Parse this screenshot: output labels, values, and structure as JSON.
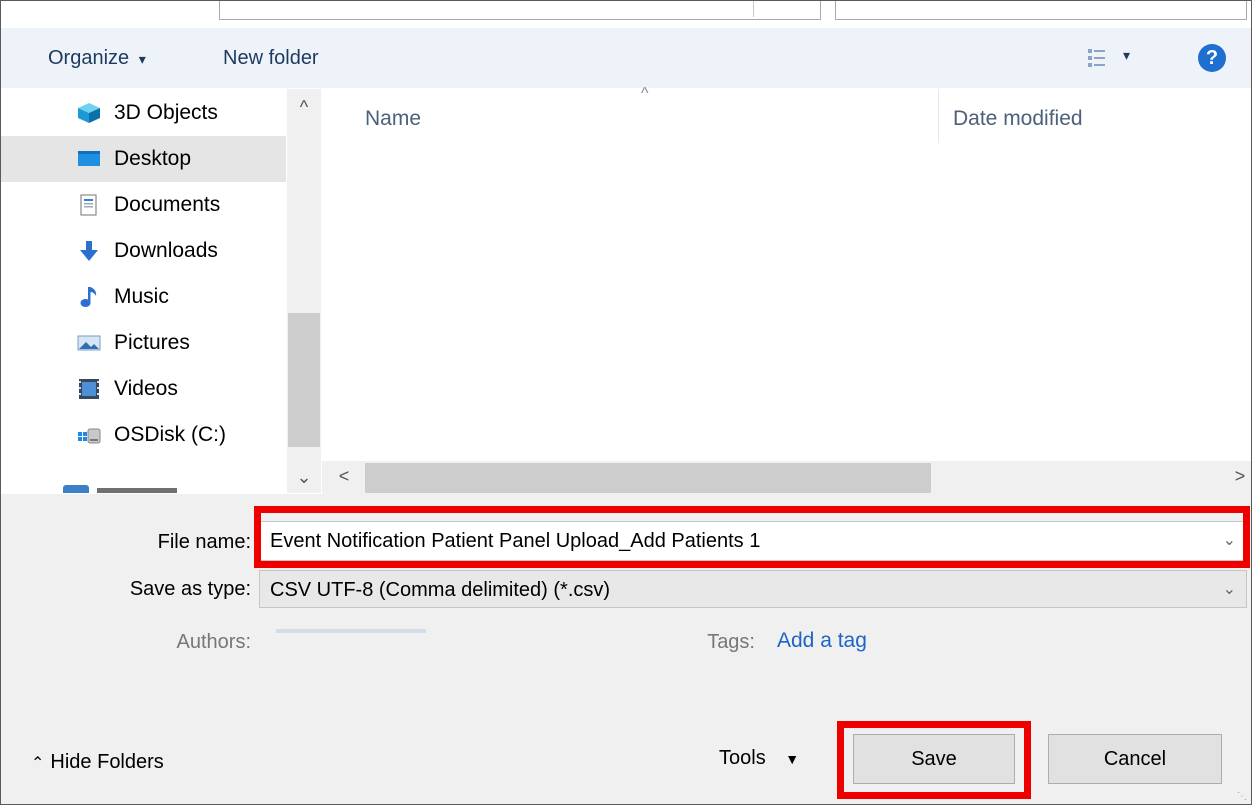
{
  "toolbar": {
    "organize_label": "Organize",
    "organize_arrow": "▾",
    "new_folder_label": "New folder",
    "view_arrow": "▾",
    "help_label": "?"
  },
  "nav": {
    "items": [
      {
        "label": "3D Objects",
        "icon": "3d-objects-icon"
      },
      {
        "label": "Desktop",
        "icon": "desktop-icon",
        "selected": true
      },
      {
        "label": "Documents",
        "icon": "documents-icon"
      },
      {
        "label": "Downloads",
        "icon": "downloads-icon"
      },
      {
        "label": "Music",
        "icon": "music-icon"
      },
      {
        "label": "Pictures",
        "icon": "pictures-icon"
      },
      {
        "label": "Videos",
        "icon": "videos-icon"
      },
      {
        "label": "OSDisk (C:)",
        "icon": "osdisk-icon"
      }
    ],
    "scroll_up": "^",
    "scroll_down": "⌄"
  },
  "list": {
    "columns": [
      "Name",
      "Date modified"
    ],
    "sort_indicator": "^",
    "scroll_left": "<",
    "scroll_right": ">"
  },
  "form": {
    "file_name_label": "File name:",
    "file_name_value": "Event Notification Patient Panel Upload_Add Patients 1",
    "save_as_type_label": "Save as type:",
    "save_as_type_value": "CSV UTF-8 (Comma delimited) (*.csv)",
    "authors_label": "Authors:",
    "tags_label": "Tags:",
    "tags_value": "Add a tag"
  },
  "footer": {
    "hide_folders_label": "Hide Folders",
    "tools_label": "Tools",
    "save_label": "Save",
    "cancel_label": "Cancel"
  },
  "colors": {
    "highlight": "#ee0000",
    "toolbar_bg": "#eef3f9",
    "link": "#1c64c8"
  }
}
